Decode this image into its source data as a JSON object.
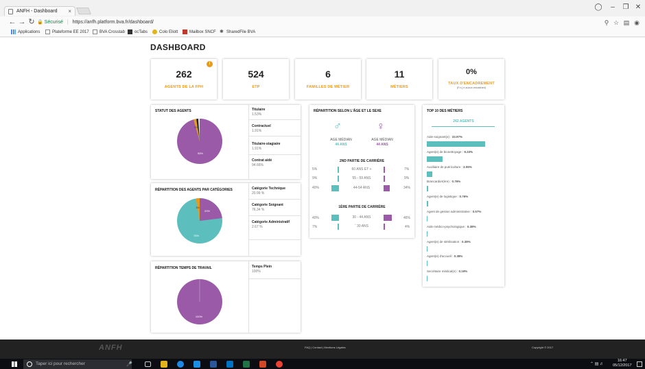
{
  "browser": {
    "tab_title": "ANFH - Dashboard",
    "tab_close": "×",
    "secure_label": "Sécurisé",
    "url": "https://anfh.platform.bva.fr/dashboard/"
  },
  "bookmarks": [
    {
      "label": "Applications"
    },
    {
      "label": "Plateforme EE 2017"
    },
    {
      "label": "BVA Crosstab"
    },
    {
      "label": "ocTabs"
    },
    {
      "label": "Colo Eliott"
    },
    {
      "label": "Mailbox SNCF"
    },
    {
      "label": "SharedFile BVA"
    }
  ],
  "page_title": "DASHBOARD",
  "kpis": [
    {
      "value": "262",
      "label": "AGENTS DE LA FPH",
      "sub": ""
    },
    {
      "value": "524",
      "label": "ETP",
      "sub": ""
    },
    {
      "value": "6",
      "label": "FAMILLES DE MÉTIER",
      "sub": ""
    },
    {
      "value": "11",
      "label": "MÉTIERS",
      "sub": ""
    },
    {
      "value": "0%",
      "label": "TAUX D'ENCADREMENT",
      "sub": "(F.n.j e aucun encadrant)"
    }
  ],
  "info_icon": "i",
  "statut": {
    "title": "STATUT DES AGENTS",
    "pie_labels": {
      "main": "95%",
      "small": "2%"
    },
    "items": [
      {
        "label": "Titulaire",
        "value": "1.53%"
      },
      {
        "label": "Contractuel",
        "value": "1.91%"
      },
      {
        "label": "Titulaire-stagiaire",
        "value": "1.91%"
      },
      {
        "label": "Contrat aidé",
        "value": "94.66%"
      }
    ]
  },
  "categories": {
    "title": "RÉPARTITION DES AGENTS PAR CATÉGORIES",
    "pie_labels": {
      "teal": "76%",
      "purple": "20%",
      "orange": "3%"
    },
    "items": [
      {
        "label": "Catégorie Technique",
        "value": "20.99 %"
      },
      {
        "label": "Catégorie Soignant",
        "value": "76.34 %"
      },
      {
        "label": "Catégorie Administratif",
        "value": "2.67 %"
      }
    ]
  },
  "temps": {
    "title": "RÉPARTITION TEMPS DE TRAVAIL",
    "pie_label": "100%",
    "items": [
      {
        "label": "Temps Plein",
        "value": "100%"
      }
    ]
  },
  "age_sexe": {
    "title": "RÉPARTITION SELON L'ÂGE ET LE SEXE",
    "male_icon": "♂",
    "female_icon": "♀",
    "male": {
      "label": "AGE MÉDIAN",
      "value": "44 ANS"
    },
    "female": {
      "label": "AGE MÉDIAN",
      "value": "44 ANS"
    },
    "second_title": "2ND PARTIE DE CARRIÈRE",
    "second_rows": [
      {
        "left": "5%",
        "range": "60 ANS ET +",
        "right": "7%",
        "lv": 5,
        "rv": 7
      },
      {
        "left": "9%",
        "range": "55 - 59 ANS",
        "right": "9%",
        "lv": 9,
        "rv": 9
      },
      {
        "left": "40%",
        "range": "44-54 ANS",
        "right": "34%",
        "lv": 40,
        "rv": 34
      }
    ],
    "first_title": "1ÈRE PARTIE DE CARRIÈRE",
    "first_rows": [
      {
        "left": "40%",
        "range": "30 - 44 ANS",
        "right": "46%",
        "lv": 40,
        "rv": 46
      },
      {
        "left": "7%",
        "range": "ˆ 30 ANS",
        "right": "4%",
        "lv": 7,
        "rv": 4
      }
    ]
  },
  "top10": {
    "title": "TOP 10 DES MÉTIERS",
    "tab": "262 AGENTS",
    "items": [
      {
        "label": "Aide-soignant(e)",
        "value": "33.97%",
        "pct": 33.97
      },
      {
        "label": "Agent(e) de bionettoyage",
        "value": "9.33%",
        "pct": 9.33
      },
      {
        "label": "Auxiliaire de puériculture",
        "value": "3.05%",
        "pct": 3.05
      },
      {
        "label": "Brancardier(ère)",
        "value": "0.76%",
        "pct": 0.76
      },
      {
        "label": "Agent(e) de logistique",
        "value": "0.76%",
        "pct": 0.76
      },
      {
        "label": "Agent de gestion administrative",
        "value": "0.57%",
        "pct": 0.57
      },
      {
        "label": "Aide médico-psychologique",
        "value": "0.38%",
        "pct": 0.38
      },
      {
        "label": "Agent(e) de stérilisation",
        "value": "0.38%",
        "pct": 0.38
      },
      {
        "label": "Agent(e) d'accueil",
        "value": "0.38%",
        "pct": 0.38
      },
      {
        "label": "Secrétaire médical(e)",
        "value": "0.19%",
        "pct": 0.19
      }
    ]
  },
  "footer": {
    "logo": "ANFH",
    "links": "FAQ | Contact | Mentions Légales",
    "copyright": "Copyright © 2017"
  },
  "taskbar": {
    "search_placeholder": "Taper ici pour rechercher",
    "time": "16:47",
    "date": "05/12/2017"
  },
  "colors": {
    "teal": "#5cbfbd",
    "purple": "#9a5aa8",
    "orange": "#e89a1b"
  }
}
